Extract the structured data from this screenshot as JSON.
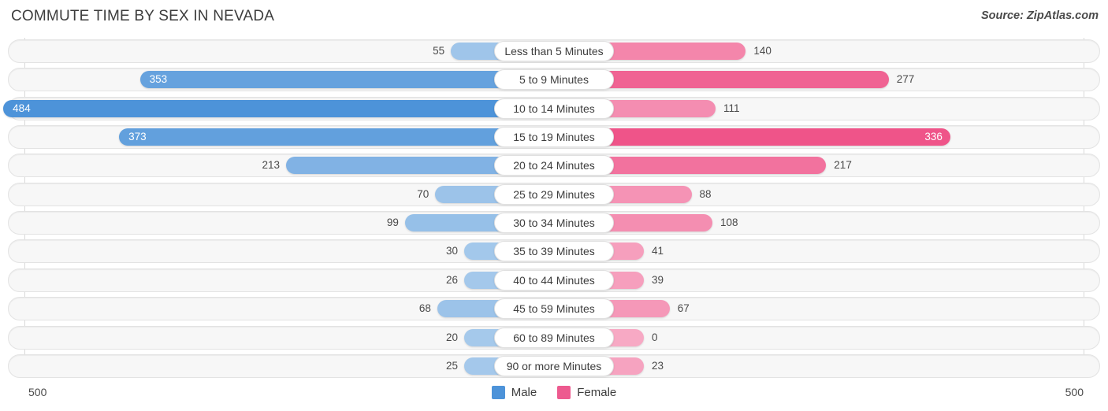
{
  "header": {
    "title": "COMMUTE TIME BY SEX IN NEVADA",
    "source": "Source: ZipAtlas.com"
  },
  "axis": {
    "left_max_label": "500",
    "right_max_label": "500",
    "max_value": 500
  },
  "legend": {
    "items": [
      {
        "label": "Male",
        "color": "#4d93d9"
      },
      {
        "label": "Female",
        "color": "#ed5a8f"
      }
    ]
  },
  "colors": {
    "male_light": "#a9cbec",
    "male_dark": "#4d93d9",
    "female_light": "#f7a9c4",
    "female_dark": "#ef5489",
    "track_fill": "#f7f7f7",
    "track_border": "#e3e3e3",
    "gridline": "#d9d9d9"
  },
  "chart_data": {
    "type": "bar",
    "title": "COMMUTE TIME BY SEX IN NEVADA",
    "subtitle": "",
    "xlabel": "",
    "ylabel": "",
    "orientation": "horizontal-diverging",
    "legend_position": "bottom-center",
    "grid": true,
    "xlim": [
      500,
      500
    ],
    "categories": [
      "Less than 5 Minutes",
      "5 to 9 Minutes",
      "10 to 14 Minutes",
      "15 to 19 Minutes",
      "20 to 24 Minutes",
      "25 to 29 Minutes",
      "30 to 34 Minutes",
      "35 to 39 Minutes",
      "40 to 44 Minutes",
      "45 to 59 Minutes",
      "60 to 89 Minutes",
      "90 or more Minutes"
    ],
    "series": [
      {
        "name": "Male",
        "values": [
          55,
          353,
          484,
          373,
          213,
          70,
          99,
          30,
          26,
          68,
          20,
          25
        ]
      },
      {
        "name": "Female",
        "values": [
          140,
          277,
          111,
          336,
          217,
          88,
          108,
          41,
          39,
          67,
          0,
          23
        ]
      }
    ]
  }
}
